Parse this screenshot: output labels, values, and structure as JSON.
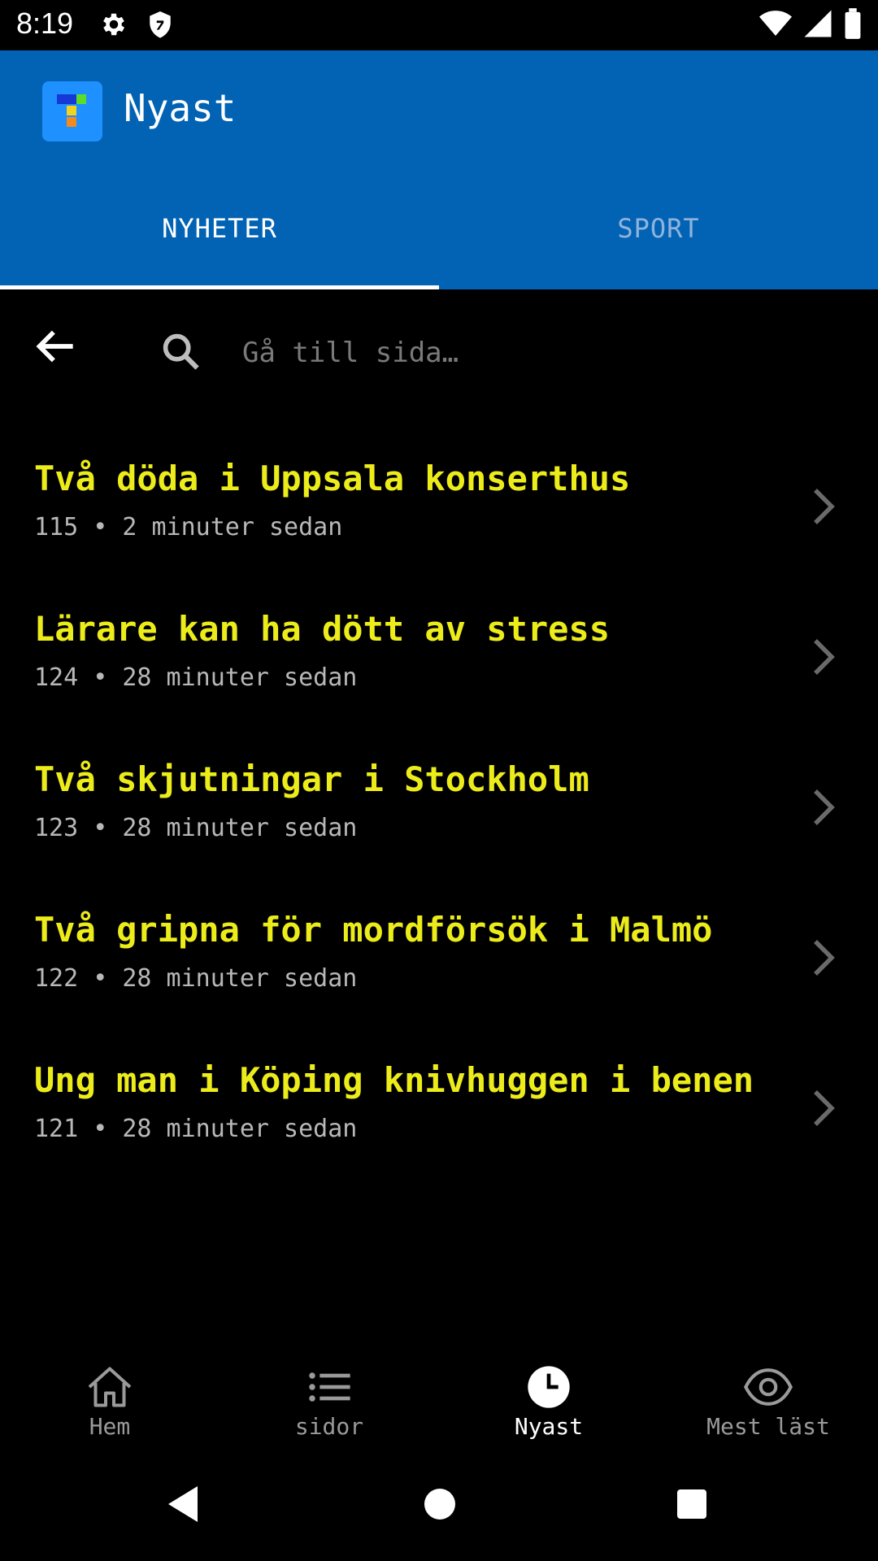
{
  "status_bar": {
    "time": "8:19",
    "icons": [
      "gear-icon",
      "shield-icon",
      "wifi-icon",
      "signal-icon",
      "battery-icon"
    ]
  },
  "app_bar": {
    "title": "Nyast",
    "color": "#0263b4",
    "tabs": [
      {
        "label": "NYHETER",
        "active": true
      },
      {
        "label": "SPORT",
        "active": false
      }
    ]
  },
  "search": {
    "placeholder": "Gå till sida…"
  },
  "news": [
    {
      "title": "Två döda i Uppsala konserthus",
      "meta": "115 • 2 minuter sedan"
    },
    {
      "title": "Lärare kan ha dött av stress",
      "meta": "124 • 28 minuter sedan"
    },
    {
      "title": "Två skjutningar i Stockholm",
      "meta": "123 • 28 minuter sedan"
    },
    {
      "title": "Två gripna för mordförsök i Malmö",
      "meta": "122 • 28 minuter sedan"
    },
    {
      "title": "Ung man i Köping knivhuggen i benen",
      "meta": "121 • 28 minuter sedan"
    }
  ],
  "headline_color": "#ecec1a",
  "bottom_nav": [
    {
      "label": "Hem",
      "icon": "home-icon",
      "active": false
    },
    {
      "label": "sidor",
      "icon": "list-icon",
      "active": false
    },
    {
      "label": "Nyast",
      "icon": "clock-icon",
      "active": true
    },
    {
      "label": "Mest läst",
      "icon": "eye-icon",
      "active": false
    }
  ]
}
